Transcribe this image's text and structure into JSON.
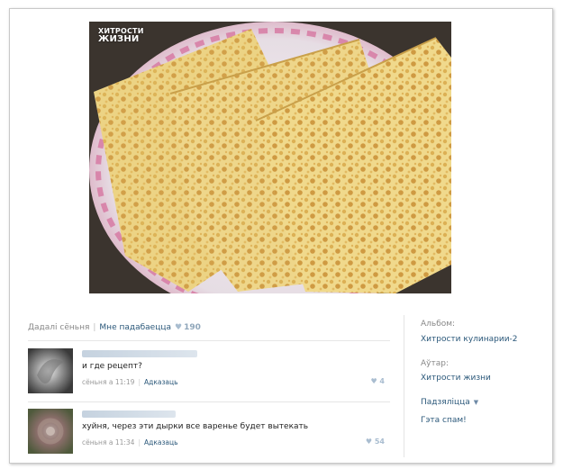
{
  "photo": {
    "watermark_line1": "ХИТРОСТИ",
    "watermark_line2": "ЖИЗНИ",
    "subject": "pancakes-photo"
  },
  "meta": {
    "share_label": "Дадалі сёньня",
    "like_label": "Мне падабаецца",
    "like_count": "190"
  },
  "comments": [
    {
      "text": "и где рецепт?",
      "time": "сёньня а 11:19",
      "reply_label": "Адказаць",
      "likes": "4"
    },
    {
      "text": "хуйня, через эти дырки все варенье будет вытекать",
      "time": "сёньня а 11:34",
      "reply_label": "Адказаць",
      "likes": "54"
    }
  ],
  "sidebar": {
    "album_label": "Альбом:",
    "album_name": "Хитрости кулинарии-2",
    "author_label": "Аўтар:",
    "author_name": "Хитрости жизни",
    "share_button": "Падзяліцца",
    "spam_link": "Гэта спам!"
  },
  "icons": {
    "heart": "heart-icon",
    "chevron": "chevron-down-icon"
  }
}
